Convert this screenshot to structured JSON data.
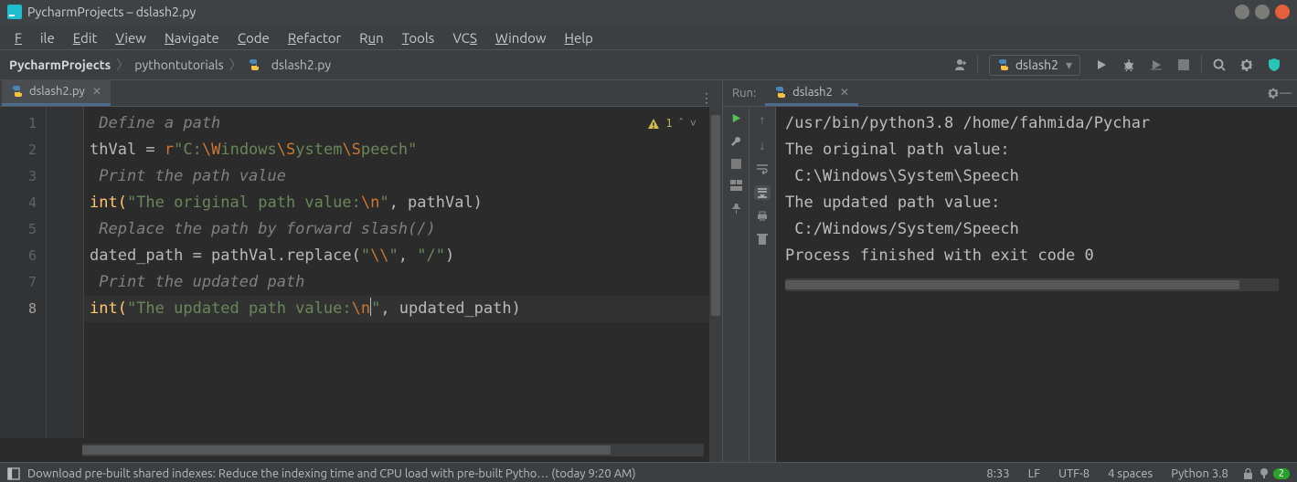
{
  "titlebar": {
    "title": "PycharmProjects – dslash2.py"
  },
  "menu": {
    "file": "File",
    "edit": "Edit",
    "view": "View",
    "navigate": "Navigate",
    "code": "Code",
    "refactor": "Refactor",
    "run": "Run",
    "tools": "Tools",
    "vcs": "VCS",
    "window": "Window",
    "help": "Help"
  },
  "breadcrumb": {
    "root": "PycharmProjects",
    "folder": "pythontutorials",
    "file": "dslash2.py"
  },
  "runconfig": {
    "label": "dslash2"
  },
  "editor_tab": {
    "label": "dslash2.py"
  },
  "inspection": {
    "count": "1"
  },
  "code": {
    "l1": " Define a path",
    "l2_a": "thVal = ",
    "l2_b": "r",
    "l2_c": "\"C:",
    "l2_d": "\\W",
    "l2_e": "indows",
    "l2_f": "\\S",
    "l2_g": "ystem",
    "l2_h": "\\S",
    "l2_i": "peech\"",
    "l3": " Print the path value",
    "l4_a": "int(",
    "l4_b": "\"The original path value:",
    "l4_c": "\\n",
    "l4_d": "\"",
    "l4_e": ", pathVal)",
    "l5": " Replace the path by forward slash(/)",
    "l6_a": "dated_path = pathVal.replace(",
    "l6_b": "\"",
    "l6_c": "\\\\",
    "l6_d": "\"",
    "l6_e": ", ",
    "l6_f": "\"/\"",
    "l6_g": ")",
    "l7": " Print the updated path",
    "l8_a": "int(",
    "l8_b": "\"The updated path value:",
    "l8_c": "\\n",
    "l8_d": "\"",
    "l8_e": ", updated_path)"
  },
  "gutter": {
    "n1": "1",
    "n2": "2",
    "n3": "3",
    "n4": "4",
    "n5": "5",
    "n6": "6",
    "n7": "7",
    "n8": "8"
  },
  "runpanel": {
    "title": "Run:",
    "tab": "dslash2",
    "out1": "/usr/bin/python3.8 /home/fahmida/Pychar",
    "out2": "The original path value:",
    "out3": " C:\\Windows\\System\\Speech",
    "out4": "The updated path value:",
    "out5": " C:/Windows/System/Speech",
    "out6": "",
    "out7": "Process finished with exit code 0"
  },
  "status": {
    "msg": "Download pre-built shared indexes: Reduce the indexing time and CPU load with pre-built Pytho… (today 9:20 AM)",
    "pos": "8:33",
    "eol": "LF",
    "enc": "UTF-8",
    "indent": "4 spaces",
    "interp": "Python 3.8",
    "badge": "2"
  }
}
